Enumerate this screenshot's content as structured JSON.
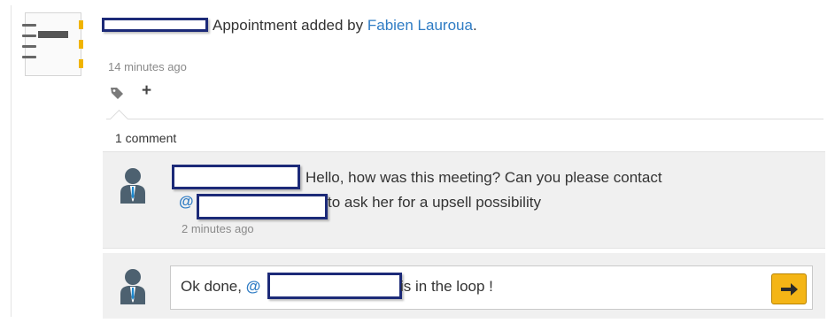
{
  "post": {
    "headline_text": "Appointment added by",
    "author": "Fabien Lauroua",
    "author_suffix": ".",
    "timestamp": "14 minutes ago",
    "icon": "notebook-icon",
    "actions": [
      {
        "icon": "tag-icon"
      },
      {
        "icon": "plus-icon",
        "label": "+"
      }
    ]
  },
  "comments": {
    "count_label": "1 comment",
    "items": [
      {
        "text_line1": "Hello, how was this meeting? Can you please contact",
        "mention_at": "@",
        "text_line2": "to ask her for a upsell possibility",
        "time": "2 minutes ago",
        "avatar": "user-avatar-icon"
      }
    ]
  },
  "reply": {
    "text_before": "Ok done,",
    "mention_at": "@",
    "text_after": "is in the loop !",
    "send_icon": "arrow-right-icon"
  },
  "colors": {
    "accent_link": "#2f7cc4",
    "send_button": "#f4b516",
    "redaction_border": "#1c2a78",
    "panel_bg": "#f0f0f0"
  }
}
